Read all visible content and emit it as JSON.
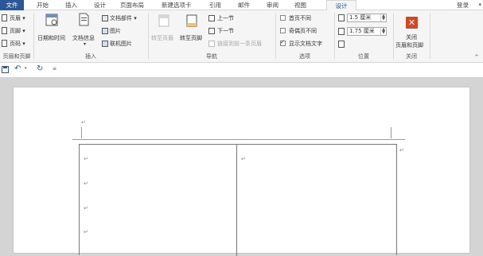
{
  "tabs": {
    "file": "文件",
    "home": "开始",
    "insert": "插入",
    "design1": "设计",
    "layout": "页面布局",
    "new_tab": "新建选项卡",
    "references": "引用",
    "mailings": "邮件",
    "review": "审阅",
    "view": "视图",
    "design_active": "设计",
    "login": "登录"
  },
  "ribbon": {
    "hf_group": {
      "header": "页眉",
      "footer": "页脚",
      "page_number": "页码",
      "label": "页眉和页脚"
    },
    "insert_group": {
      "datetime": "日期和时间",
      "docinfo": "文档信息",
      "quickparts": "文档部件",
      "picture": "图片",
      "online_picture": "联机图片",
      "label": "插入"
    },
    "nav_group": {
      "goto_header": "转至页眉",
      "goto_footer": "转至页脚",
      "prev": "上一节",
      "next": "下一节",
      "link_prev": "链接到前一条页眉",
      "label": "导航"
    },
    "options_group": {
      "diff_first": "首页不同",
      "diff_odd_even": "奇偶页不同",
      "show_text": "显示文档文字",
      "label": "选项"
    },
    "position_group": {
      "header_pos": "1.5 厘米",
      "footer_pos": "1.75 厘米",
      "label": "位置"
    },
    "close_group": {
      "close_line1": "关闭",
      "close_line2": "页眉和页脚",
      "label": "关闭"
    }
  },
  "document": {
    "para_mark": "↵"
  }
}
